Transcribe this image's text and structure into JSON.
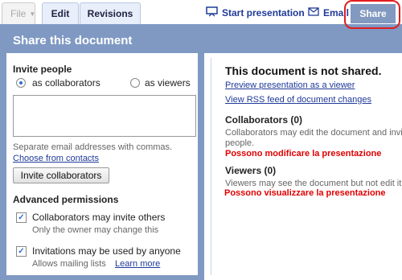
{
  "tabs": {
    "file": "File",
    "edit": "Edit",
    "revisions": "Revisions"
  },
  "toolbar": {
    "start_presentation": "Start presentation",
    "email": "Email",
    "share": "Share"
  },
  "panel": {
    "title": "Share this document",
    "invite_heading": "Invite people",
    "as_collaborators": "as collaborators",
    "as_viewers": "as viewers",
    "email_hint": "Separate email addresses with commas.",
    "choose_contacts": "Choose from contacts",
    "invite_button": "Invite collaborators",
    "advanced_heading": "Advanced permissions",
    "perm1_label": "Collaborators may invite others",
    "perm1_note": "Only the owner may change this",
    "perm2_label": "Invitations may be used by anyone",
    "perm2_note": "Allows mailing lists",
    "learn_more": "Learn more"
  },
  "status": {
    "title": "This document is not shared.",
    "preview_link": "Preview presentation as a viewer",
    "rss_link": "View RSS feed of document changes",
    "collaborators_heading": "Collaborators (0)",
    "collaborators_desc": "Collaborators may edit the document and invite",
    "collaborators_desc2": "people.",
    "collaborators_note": "Possono modificare la presentazione",
    "viewers_heading": "Viewers (0)",
    "viewers_desc": "Viewers may see the document but not edit it.",
    "viewers_note": "Possono visualizzare la presentazione"
  },
  "colors": {
    "accent": "#7f99c3",
    "link": "#1f3a99",
    "annotation": "#e00000"
  }
}
